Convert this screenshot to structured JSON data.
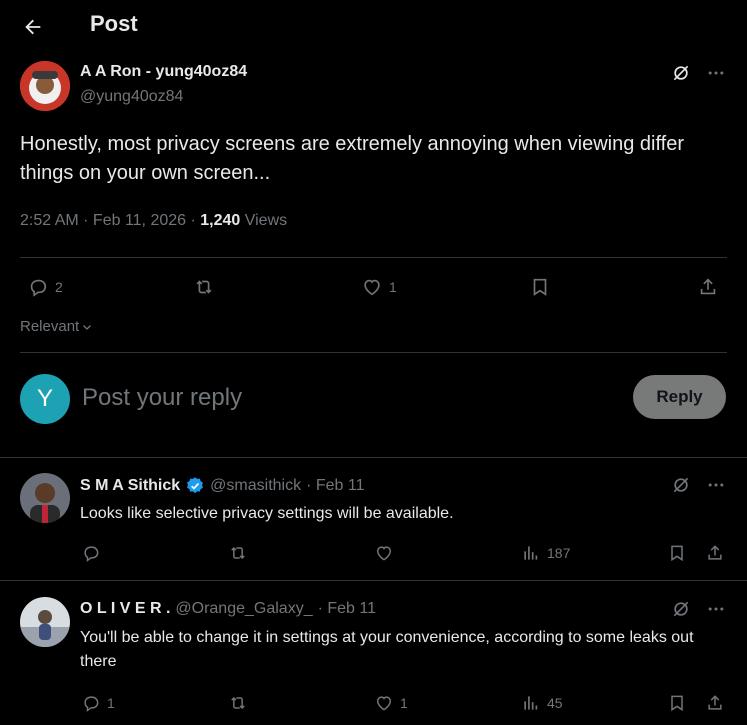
{
  "header": {
    "title": "Post"
  },
  "post": {
    "author_name": "A A Ron - yung40oz84",
    "author_handle": "@yung40oz84",
    "text": "Honestly, most privacy screens are extremely annoying when viewing differ things on your own screen...",
    "time": "2:52 AM · Feb 11, 2026 · ",
    "views_count": "1,240",
    "views_label": " Views",
    "replies": "2",
    "reposts": "",
    "likes": "1"
  },
  "sort": {
    "label": "Relevant"
  },
  "composer": {
    "avatar_letter": "Y",
    "placeholder": "Post your reply",
    "reply_label": "Reply"
  },
  "replies": [
    {
      "name": "S M A Sithick",
      "handle": "@smasithick",
      "date": "· Feb 11",
      "text": "Looks like selective privacy settings will be available.",
      "replies": "",
      "reposts": "",
      "likes": "",
      "views": "187"
    },
    {
      "name": "O L I V E R .",
      "handle": "@Orange_Galaxy_",
      "date": "· Feb 11",
      "text": "You'll be able to change it in settings at your convenience, according to some leaks out there",
      "replies": "1",
      "reposts": "",
      "likes": "1",
      "views": "45"
    }
  ],
  "colors": {
    "background": "#000000",
    "text": "#e7e9ea",
    "muted": "#71767b",
    "divider": "#2f3336",
    "verified": "#1d9bf0",
    "avatar_y": "#1da2b4"
  }
}
